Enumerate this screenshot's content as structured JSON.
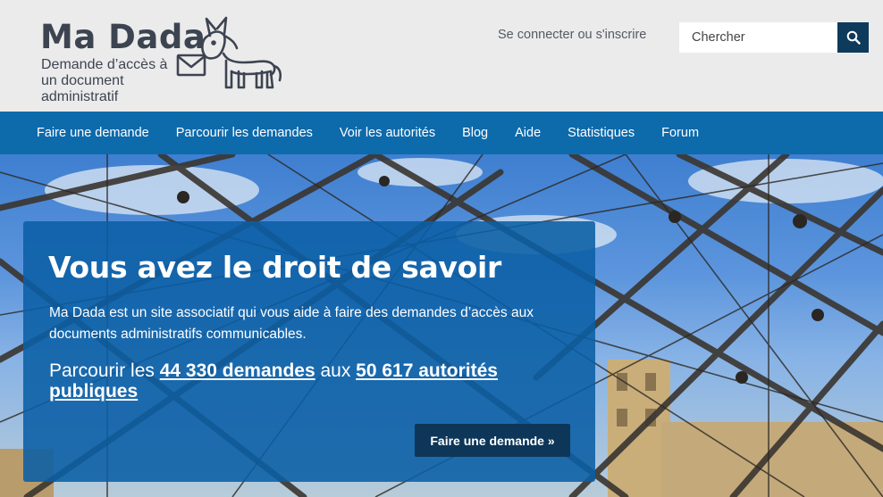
{
  "site": {
    "name": "Ma Dada",
    "tagline": "Demande d’accès à un document administratif"
  },
  "header": {
    "login_label": "Se connecter ou s'inscrire",
    "search_placeholder": "Chercher",
    "search_icon": "search-icon"
  },
  "nav": {
    "items": [
      {
        "label": "Faire une demande"
      },
      {
        "label": "Parcourir les demandes"
      },
      {
        "label": "Voir les autorités"
      },
      {
        "label": "Blog"
      },
      {
        "label": "Aide"
      },
      {
        "label": "Statistiques"
      },
      {
        "label": "Forum"
      }
    ]
  },
  "hero": {
    "title": "Vous avez le droit de savoir",
    "description": "Ma Dada est un site associatif qui vous aide à faire des demandes d’accès aux documents administratifs communicables.",
    "stats_prefix": "Parcourir les ",
    "requests_link": "44 330 demandes",
    "stats_middle": " aux ",
    "authorities_link": "50 617 autorités publiques",
    "cta_label": "Faire une demande »"
  },
  "colors": {
    "nav_bg": "#0d6aab",
    "search_btn": "#0e3a5c",
    "panel_bg": "#0a5fa5",
    "cta_bg": "#0d3658",
    "logo_text": "#3d4451"
  }
}
